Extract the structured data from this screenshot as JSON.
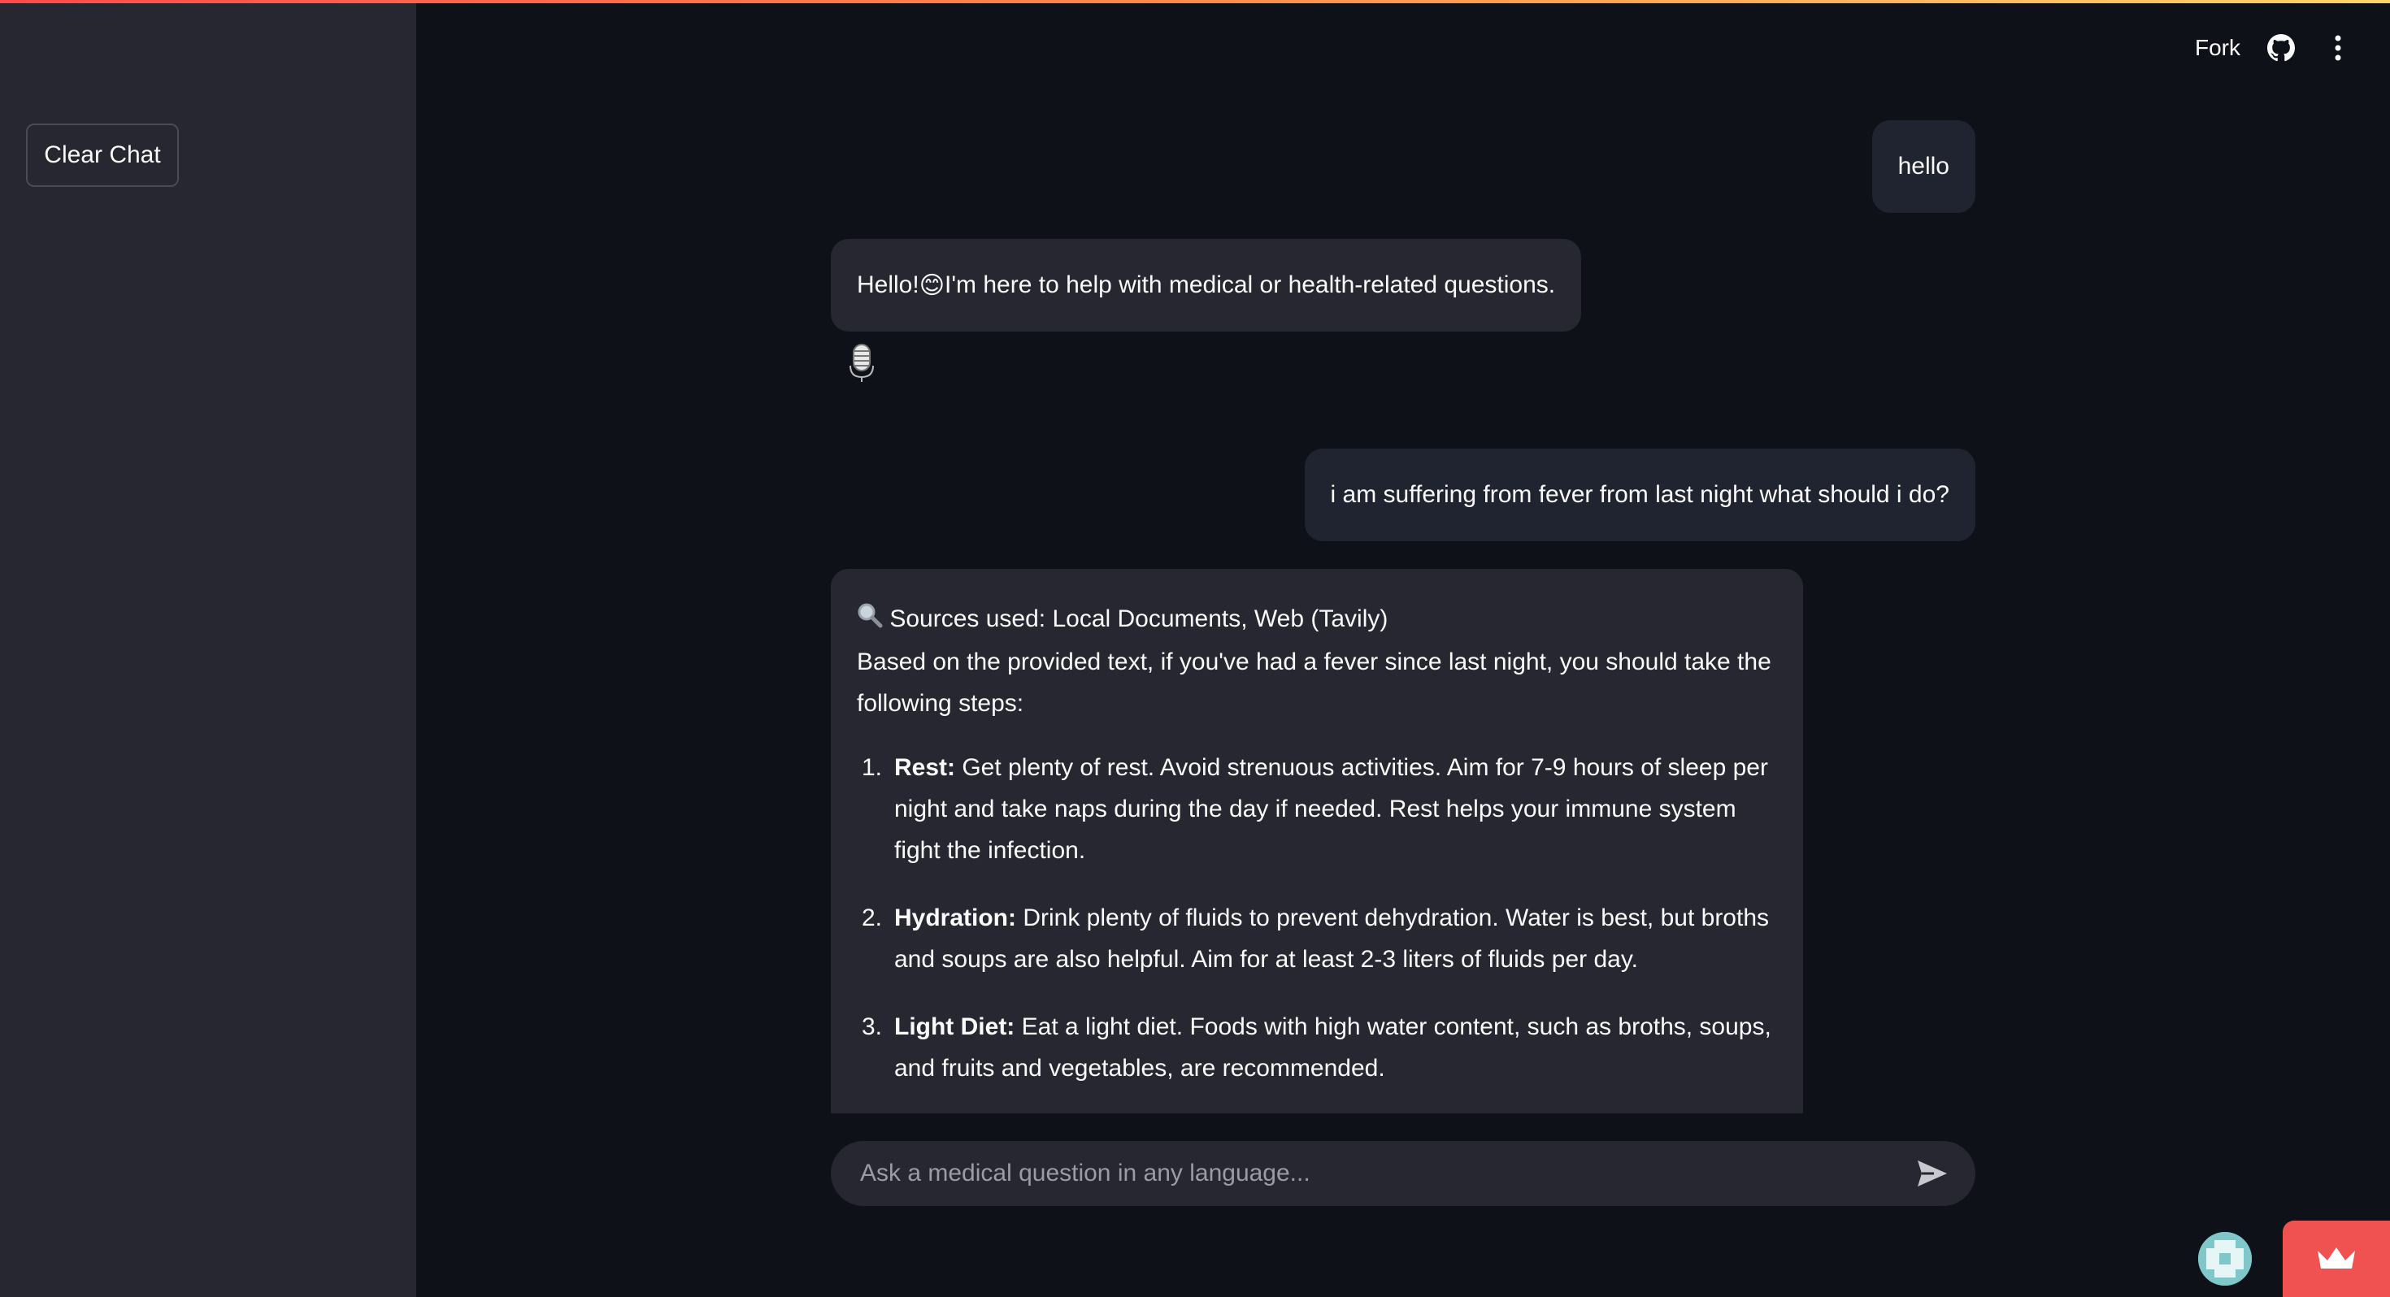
{
  "header": {
    "fork_label": "Fork",
    "github_icon": "github-icon",
    "menu_icon": "kebab-menu-icon"
  },
  "sidebar": {
    "clear_chat_label": "Clear Chat"
  },
  "messages": {
    "user_1": "hello",
    "bot_1_prefix": "Hello! ",
    "bot_1_emoji": "😊",
    "bot_1_text": " I'm here to help with medical or health-related questions.",
    "user_2": "i am suffering from fever from last night what should i do?",
    "bot_2": {
      "sources_label": "Sources used: Local Documents, Web (Tavily)",
      "intro": "Based on the provided text, if you've had a fever since last night, you should take the following steps:",
      "steps": [
        {
          "number": "1.",
          "title": "Rest:",
          "text": " Get plenty of rest. Avoid strenuous activities. Aim for 7-9 hours of sleep per night and take naps during the day if needed. Rest helps your immune system fight the infection."
        },
        {
          "number": "2.",
          "title": "Hydration:",
          "text": " Drink plenty of fluids to prevent dehydration. Water is best, but broths and soups are also helpful. Aim for at least 2-3 liters of fluids per day."
        },
        {
          "number": "3.",
          "title": "Light Diet:",
          "text": " Eat a light diet. Foods with high water content, such as broths, soups, and fruits and vegetables, are recommended."
        }
      ]
    }
  },
  "chat_input": {
    "placeholder": "Ask a medical question in any language..."
  },
  "colors": {
    "background": "#0e1117",
    "sidebar": "#262730",
    "user_bubble": "#1f2430",
    "bot_bubble": "#262730",
    "accent_red": "#f05252"
  }
}
